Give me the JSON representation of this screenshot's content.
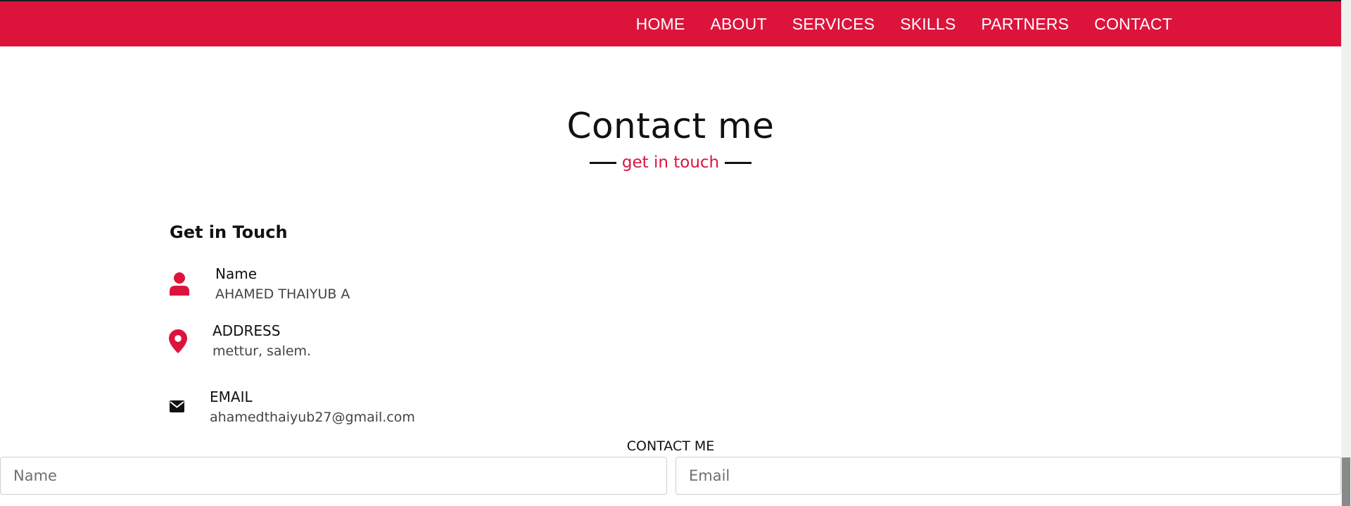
{
  "colors": {
    "accent": "#dc143c",
    "nav_text": "#ffffff",
    "heading": "#111111",
    "body_text": "#444444"
  },
  "nav": {
    "items": [
      {
        "label": "HOME"
      },
      {
        "label": "ABOUT"
      },
      {
        "label": "SERVICES"
      },
      {
        "label": "SKILLS"
      },
      {
        "label": "PARTNERS"
      },
      {
        "label": "CONTACT"
      }
    ]
  },
  "section": {
    "title": "Contact me",
    "subtitle": "get in touch"
  },
  "contact_info": {
    "heading": "Get in Touch",
    "items": [
      {
        "icon": "user-icon",
        "label": "Name",
        "value": "AHAMED THAIYUB A"
      },
      {
        "icon": "map-pin-icon",
        "label": "ADDRESS",
        "value": "mettur, salem."
      },
      {
        "icon": "envelope-icon",
        "label": "EMAIL",
        "value": "ahamedthaiyub27@gmail.com"
      }
    ]
  },
  "form": {
    "title": "CONTACT ME",
    "name_placeholder": "Name",
    "email_placeholder": "Email"
  }
}
